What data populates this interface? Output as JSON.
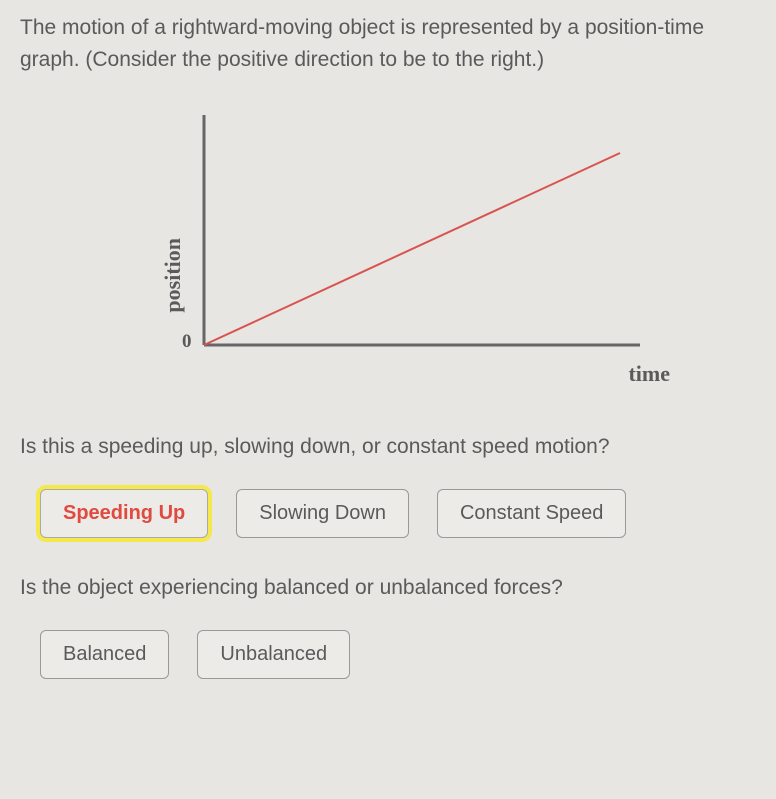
{
  "prompt": "The motion of a rightward-moving object is represented by a position-time graph. (Consider the positive direction to be to the right.)",
  "chart_data": {
    "type": "line",
    "x": [
      0,
      10
    ],
    "values": [
      0,
      5
    ],
    "title": "",
    "xlabel": "time",
    "ylabel": "position",
    "origin": "0",
    "xlim": [
      0,
      10
    ],
    "ylim": [
      0,
      10
    ]
  },
  "question1": {
    "text": "Is this a speeding up, slowing down, or constant speed motion?",
    "options": {
      "speeding_up": "Speeding Up",
      "slowing_down": "Slowing Down",
      "constant_speed": "Constant Speed"
    },
    "selected": "speeding_up"
  },
  "question2": {
    "text": "Is the object experiencing balanced or unbalanced forces?",
    "options": {
      "balanced": "Balanced",
      "unbalanced": "Unbalanced"
    }
  },
  "colors": {
    "axis": "#666666",
    "data_line": "#d9534f",
    "highlight": "#f4e84d"
  }
}
